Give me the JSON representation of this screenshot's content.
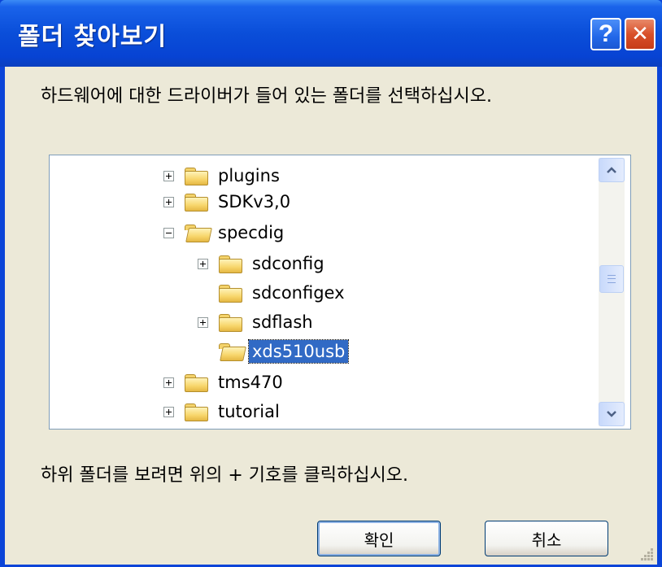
{
  "dialog": {
    "title": "폴더 찾아보기",
    "help_label": "?",
    "close_label": "✕",
    "instruction": "하드웨어에 대한 드라이버가 들어 있는 폴더를 선택하십시오.",
    "hint": "하위 폴더를 보려면 위의 + 기호를 클릭하십시오.",
    "ok_label": "확인",
    "cancel_label": "취소"
  },
  "tree": {
    "items": [
      {
        "label": "plugins",
        "expander": "plus",
        "level": 0,
        "selected": false
      },
      {
        "label": "SDKv3,0",
        "expander": "plus",
        "level": 0,
        "selected": false
      },
      {
        "label": "specdig",
        "expander": "minus",
        "level": 0,
        "selected": false
      },
      {
        "label": "sdconfig",
        "expander": "plus",
        "level": 1,
        "selected": false
      },
      {
        "label": "sdconfigex",
        "expander": "none",
        "level": 1,
        "selected": false
      },
      {
        "label": "sdflash",
        "expander": "plus",
        "level": 1,
        "selected": false
      },
      {
        "label": "xds510usb",
        "expander": "none",
        "level": 1,
        "selected": true
      },
      {
        "label": "tms470",
        "expander": "plus",
        "level": 0,
        "selected": false
      },
      {
        "label": "tutorial",
        "expander": "plus",
        "level": 0,
        "selected": false
      }
    ]
  },
  "icons": {
    "help": "help-icon",
    "close": "close-icon",
    "folder": "folder-icon",
    "scroll_up": "chevron-up-icon",
    "scroll_down": "chevron-down-icon"
  },
  "colors": {
    "titlebar": "#0a4ed9",
    "selection": "#316ac5",
    "dialog_bg": "#ece9d8"
  }
}
